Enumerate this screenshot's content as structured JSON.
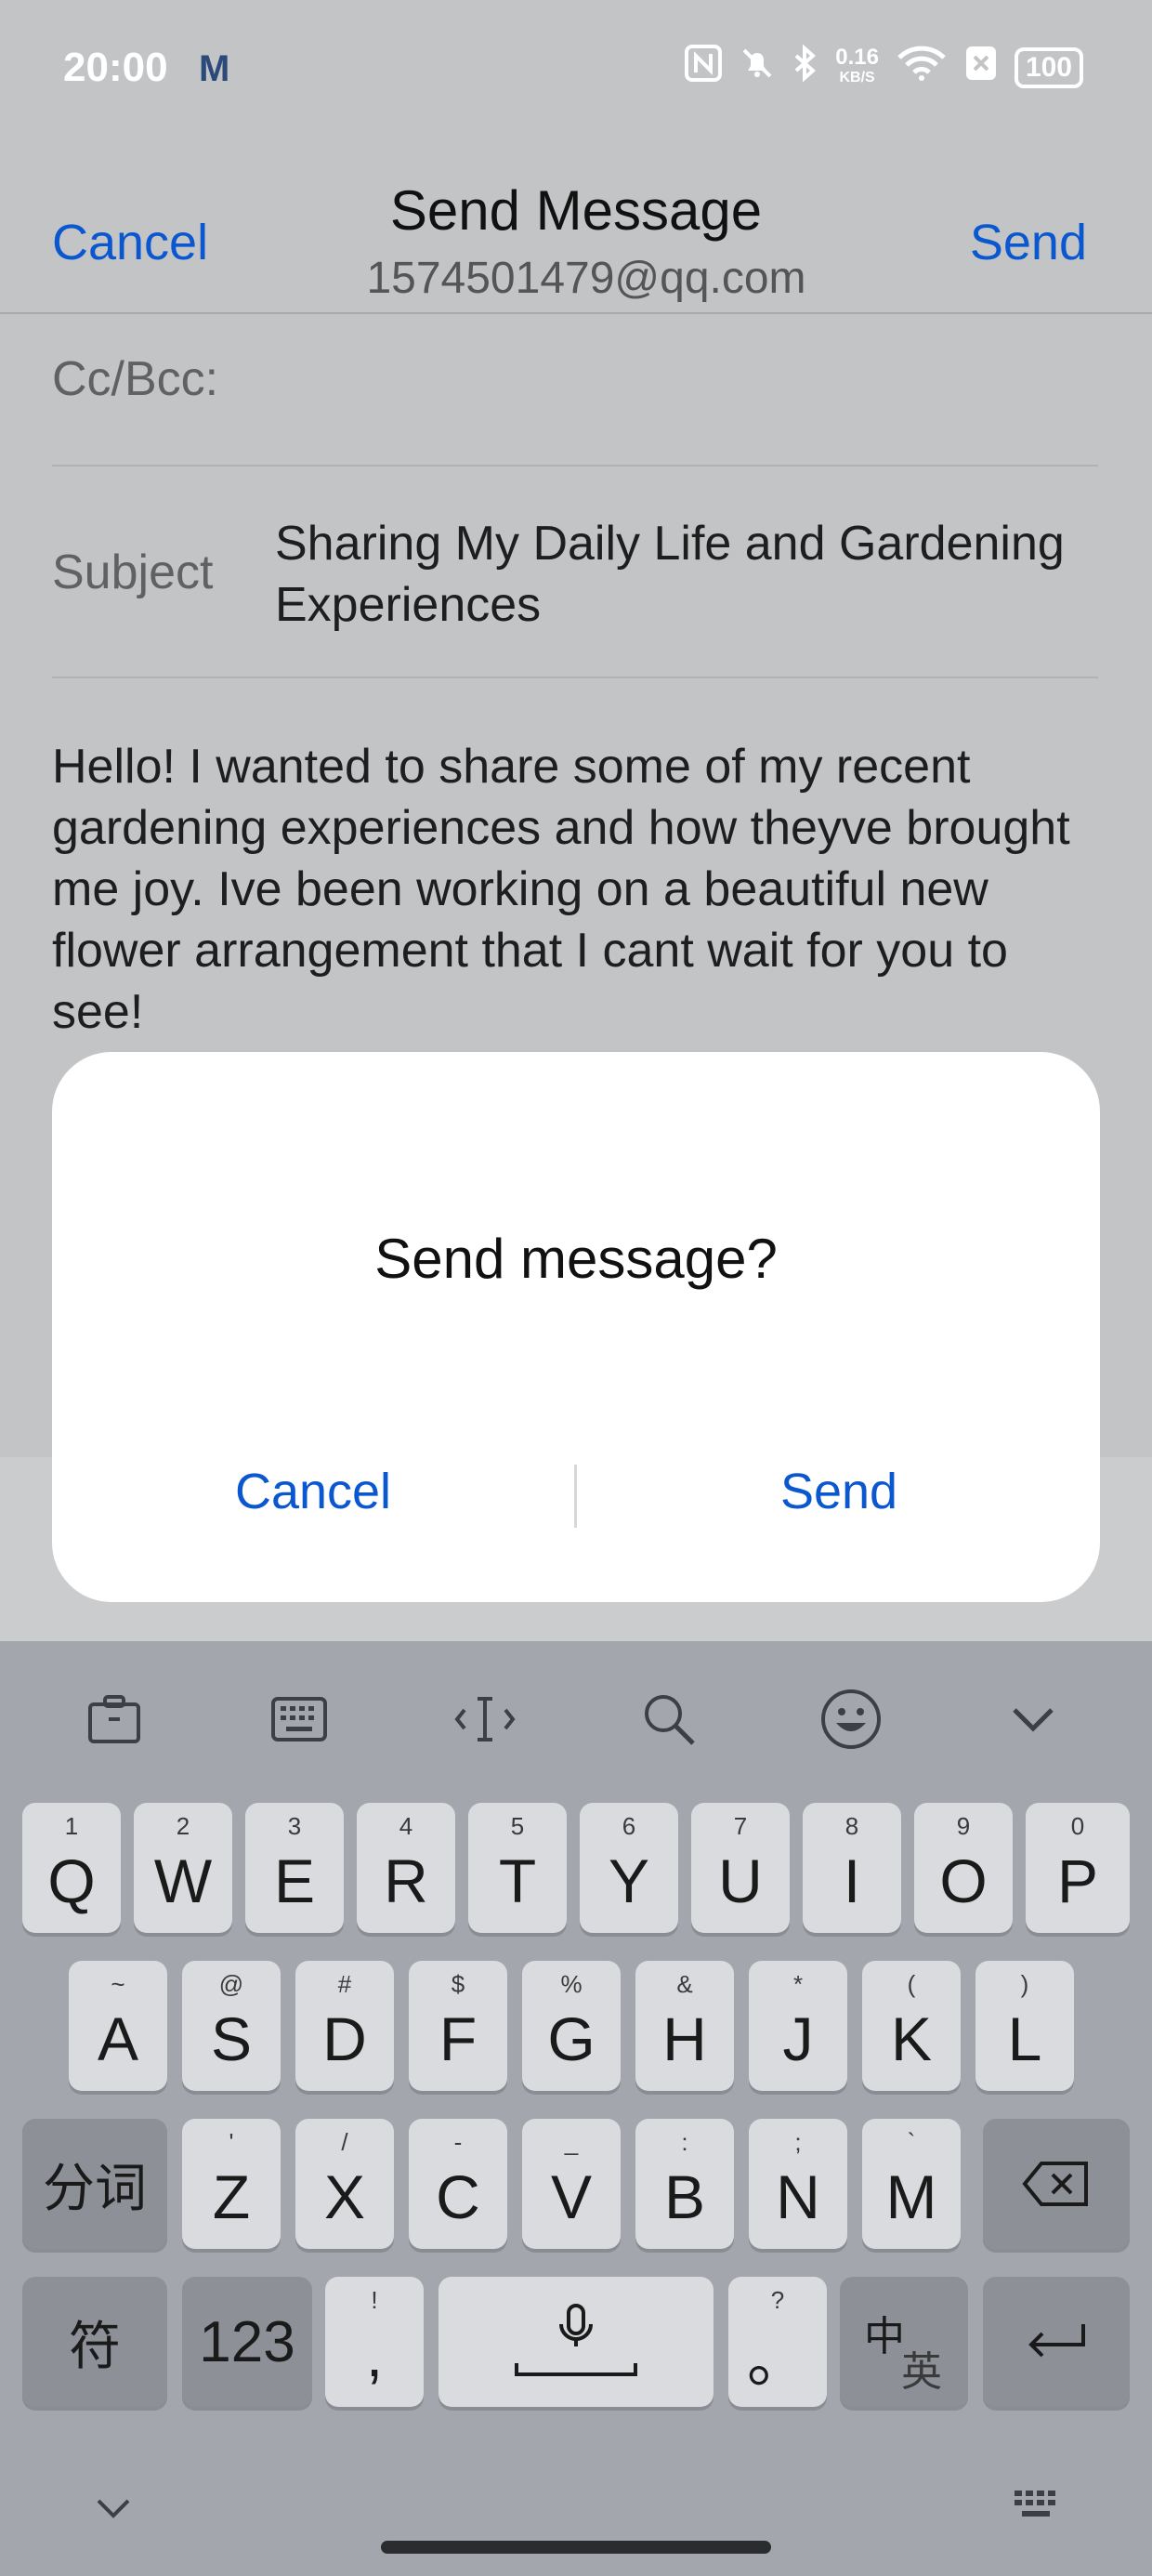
{
  "status_bar": {
    "time": "20:00",
    "speed_value": "0.16",
    "speed_unit": "KB/S",
    "battery": "100",
    "icons": [
      "mail-notification-icon",
      "nfc-icon",
      "mute-icon",
      "bluetooth-icon",
      "wifi-icon",
      "sim-off-icon",
      "battery-icon"
    ]
  },
  "header": {
    "cancel_label": "Cancel",
    "title": "Send Message",
    "from_address": "1574501479@qq.com",
    "send_label": "Send"
  },
  "compose": {
    "cc_label": "Cc/Bcc:",
    "subject_label": "Subject",
    "subject_value": "Sharing My Daily Life and Gardening Experiences",
    "body": "Hello! I wanted to share some of my recent gardening experiences and how theyve brought me joy. Ive been working on a beautiful new flower arrangement that I cant wait for you to see!"
  },
  "dialog": {
    "title": "Send message?",
    "cancel_label": "Cancel",
    "send_label": "Send"
  },
  "keyboard": {
    "toolbar_icons": [
      "clipboard-icon",
      "keyboard-layout-icon",
      "cursor-icon",
      "search-icon",
      "emoji-icon",
      "collapse-icon"
    ],
    "row1": [
      {
        "key": "Q",
        "hint": "1"
      },
      {
        "key": "W",
        "hint": "2"
      },
      {
        "key": "E",
        "hint": "3"
      },
      {
        "key": "R",
        "hint": "4"
      },
      {
        "key": "T",
        "hint": "5"
      },
      {
        "key": "Y",
        "hint": "6"
      },
      {
        "key": "U",
        "hint": "7"
      },
      {
        "key": "I",
        "hint": "8"
      },
      {
        "key": "O",
        "hint": "9"
      },
      {
        "key": "P",
        "hint": "0"
      }
    ],
    "row2": [
      {
        "key": "A",
        "hint": "~"
      },
      {
        "key": "S",
        "hint": "@"
      },
      {
        "key": "D",
        "hint": "#"
      },
      {
        "key": "F",
        "hint": "$"
      },
      {
        "key": "G",
        "hint": "%"
      },
      {
        "key": "H",
        "hint": "&"
      },
      {
        "key": "J",
        "hint": "*"
      },
      {
        "key": "K",
        "hint": "("
      },
      {
        "key": "L",
        "hint": ")"
      }
    ],
    "row3": [
      {
        "key": "Z",
        "hint": "'"
      },
      {
        "key": "X",
        "hint": "/"
      },
      {
        "key": "C",
        "hint": "-"
      },
      {
        "key": "V",
        "hint": "_"
      },
      {
        "key": "B",
        "hint": ":"
      },
      {
        "key": "N",
        "hint": ";"
      },
      {
        "key": "M",
        "hint": "`"
      }
    ],
    "segment_key": "分词",
    "symbol_key": "符",
    "numbers_key": "123",
    "comma_key": ",",
    "comma_hint": "!",
    "period_key": "。",
    "period_hint": "?",
    "lang_key_cn": "中",
    "lang_key_en": "英"
  }
}
